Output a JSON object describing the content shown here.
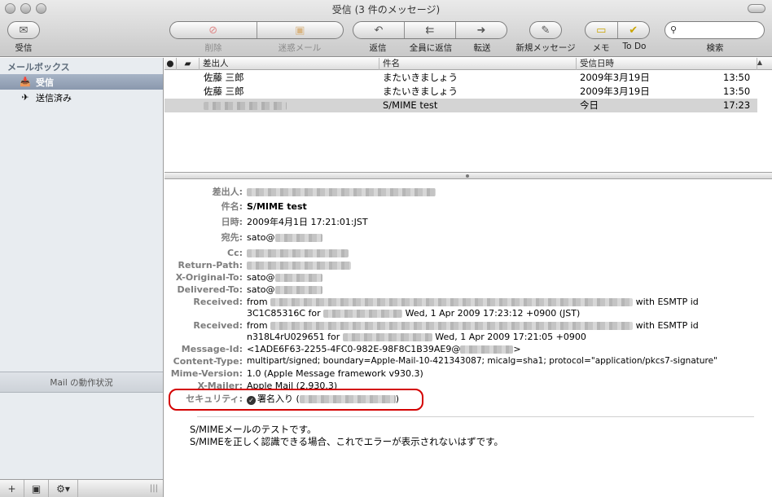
{
  "window": {
    "title": "受信 (3 件のメッセージ)"
  },
  "toolbar": {
    "inbox_label": "受信",
    "delete_label": "削除",
    "junk_label": "迷惑メール",
    "reply_label": "返信",
    "reply_all_label": "全員に返信",
    "forward_label": "転送",
    "new_message_label": "新規メッセージ",
    "note_label": "メモ",
    "todo_label": "To Do",
    "search_label": "検索"
  },
  "sidebar": {
    "header": "メールボックス",
    "items": [
      {
        "label": "受信",
        "icon": "inbox-icon",
        "selected": true
      },
      {
        "label": "送信済み",
        "icon": "sent-icon",
        "selected": false
      }
    ],
    "activity_label": "Mail の動作状況"
  },
  "message_list": {
    "columns": [
      "差出人",
      "件名",
      "受信日時"
    ],
    "rows": [
      {
        "from": "佐藤 三郎",
        "subject": "またいきましょう",
        "date": "2009年3月19日",
        "time": "13:50",
        "selected": false
      },
      {
        "from": "",
        "subject": "またいきましょう",
        "date": "2009年3月19日",
        "time": "13:50",
        "selected": false
      },
      {
        "from": "",
        "subject": "S/MIME test",
        "date": "今日",
        "time": "17:23",
        "selected": true
      }
    ]
  },
  "message": {
    "headers": [
      {
        "key": "差出人:",
        "value": "",
        "bold": false
      },
      {
        "key": "件名:",
        "value": "S/MIME test",
        "bold": true
      },
      {
        "key": "日時:",
        "value": "2009年4月1日 17:21:01:JST",
        "bold": false
      },
      {
        "key": "宛先:",
        "value": "sato@",
        "bold": false
      },
      {
        "key": "Cc:",
        "value": "",
        "bold": false
      },
      {
        "key": "Return-Path:",
        "value": "",
        "bold": false
      },
      {
        "key": "X-Original-To:",
        "value": "sato@",
        "bold": false
      },
      {
        "key": "Delivered-To:",
        "value": "sato@",
        "bold": false
      }
    ],
    "received1": {
      "key": "Received:",
      "line1_prefix": "from",
      "line1_suffix": "with ESMTP id",
      "line2_prefix": "3C1C85316C for",
      "line2_suffix": "Wed, 1 Apr 2009 17:23:12 +0900 (JST)"
    },
    "received2": {
      "key": "Received:",
      "line1_prefix": "from",
      "line1_suffix": "with ESMTP id",
      "line2_prefix": "n318L4rU029651 for",
      "line2_suffix": "Wed, 1 Apr 2009 17:21:05 +0900"
    },
    "message_id": {
      "key": "Message-Id:",
      "value_prefix": "<1ADE6F63-2255-4FC0-982E-98F8C1B39AE9@",
      "value_suffix": ">"
    },
    "content_type": {
      "key": "Content-Type:",
      "value": "multipart/signed; boundary=Apple-Mail-10-421343087; micalg=sha1; protocol=\"application/pkcs7-signature\""
    },
    "mime_version": {
      "key": "Mime-Version:",
      "value": "1.0 (Apple Message framework v930.3)"
    },
    "x_mailer": {
      "key": "X-Mailer:",
      "value": "Apple Mail (2.930.3)"
    },
    "security": {
      "key": "セキュリティ:",
      "value": "署名入り (",
      "suffix": ")"
    },
    "body": [
      "S/MIMEメールのテストです。",
      "S/MIMEを正しく認識できる場合、これでエラーが表示されないはずです。"
    ]
  }
}
